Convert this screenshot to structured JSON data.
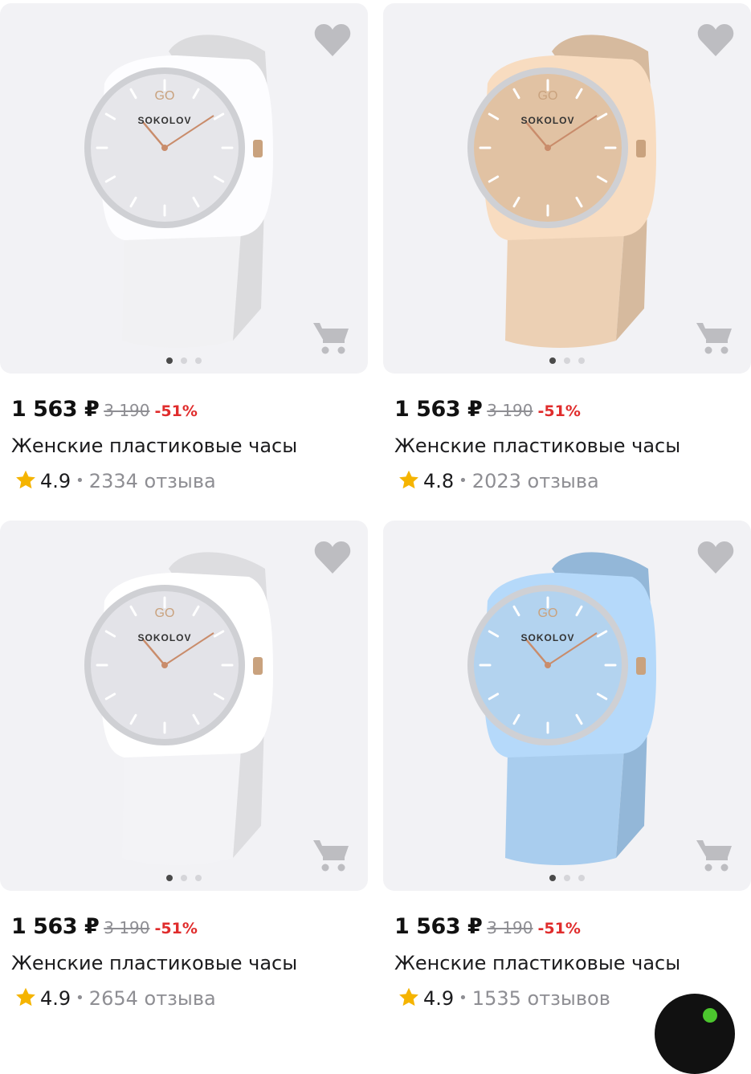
{
  "colors": {
    "accent_discount": "#e02c2c",
    "star": "#f5b400",
    "card_bg": "#f2f2f5"
  },
  "icons": {
    "favorite": "heart-icon",
    "cart": "cart-icon",
    "rating": "star-icon"
  },
  "products": [
    {
      "strap_color": "#f1f1f3",
      "dial_color": "#e6e6ea",
      "brand_mark": "GO",
      "brand": "SOKOLOV",
      "price": "1 563 ₽",
      "old_price": "3 190",
      "discount": "-51%",
      "title": "Женские пластиковые часы",
      "rating": "4.9",
      "reviews": "2334 отзыва",
      "photo_index": 1,
      "photo_count": 3
    },
    {
      "strap_color": "#ecd0b4",
      "dial_color": "#e1c2a3",
      "brand_mark": "GO",
      "brand": "SOKOLOV",
      "price": "1 563 ₽",
      "old_price": "3 190",
      "discount": "-51%",
      "title": "Женские пластиковые часы",
      "rating": "4.8",
      "reviews": "2023 отзыва",
      "photo_index": 1,
      "photo_count": 3
    },
    {
      "strap_color": "#f3f3f6",
      "dial_color": "#e3e3e8",
      "brand_mark": "GO",
      "brand": "SOKOLOV",
      "price": "1 563 ₽",
      "old_price": "3 190",
      "discount": "-51%",
      "title": "Женские пластиковые часы",
      "rating": "4.9",
      "reviews": "2654 отзыва",
      "photo_index": 1,
      "photo_count": 3
    },
    {
      "strap_color": "#a9cdee",
      "dial_color": "#b3d3ef",
      "brand_mark": "GO",
      "brand": "SOKOLOV",
      "price": "1 563 ₽",
      "old_price": "3 190",
      "discount": "-51%",
      "title": "Женские пластиковые часы",
      "rating": "4.9",
      "reviews": "1535 отзывов",
      "photo_index": 1,
      "photo_count": 3
    }
  ]
}
